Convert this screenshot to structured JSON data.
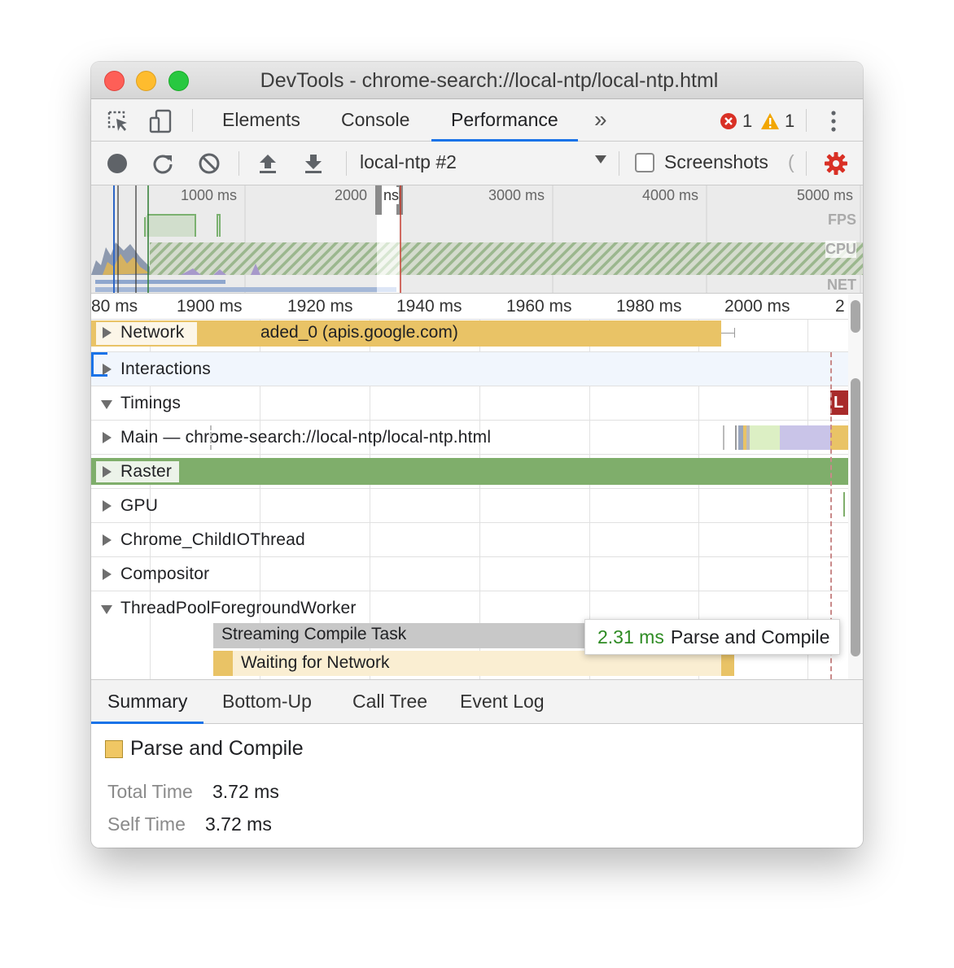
{
  "window": {
    "title": "DevTools - chrome-search://local-ntp/local-ntp.html"
  },
  "tabbar": {
    "tabs": [
      {
        "label": "Elements"
      },
      {
        "label": "Console"
      },
      {
        "label": "Performance"
      }
    ],
    "active_tab": "Performance",
    "more_icon": "chevron-double-right-icon",
    "errors": "1",
    "warnings": "1"
  },
  "toolbar": {
    "target": "local-ntp #2",
    "screenshots_label": "Screenshots",
    "screenshots_checked": false
  },
  "overview": {
    "ticks": [
      "1000 ms",
      "2000",
      "ns",
      "3000 ms",
      "4000 ms",
      "5000 ms"
    ],
    "tracks": [
      "FPS",
      "CPU",
      "NET"
    ]
  },
  "ruler": {
    "ticks": [
      "80 ms",
      "1900 ms",
      "1920 ms",
      "1940 ms",
      "1960 ms",
      "1980 ms",
      "2000 ms",
      "2"
    ]
  },
  "flame": {
    "tracks": [
      {
        "label": "Network",
        "bar_text": "aded_0 (apis.google.com)",
        "expanded": false
      },
      {
        "label": "Interactions",
        "expanded": false
      },
      {
        "label": "Timings",
        "expanded": true,
        "marker": "L"
      },
      {
        "label": "Main — chrome-search://local-ntp/local-ntp.html",
        "expanded": false
      },
      {
        "label": "Raster",
        "expanded": false
      },
      {
        "label": "GPU",
        "expanded": false
      },
      {
        "label": "Chrome_ChildIOThread",
        "expanded": false
      },
      {
        "label": "Compositor",
        "expanded": false
      },
      {
        "label": "ThreadPoolForegroundWorker",
        "expanded": true
      }
    ],
    "events": [
      {
        "label": "Streaming Compile Task"
      },
      {
        "label": "Waiting for Network"
      }
    ]
  },
  "tooltip": {
    "duration": "2.31 ms",
    "name": "Parse and Compile"
  },
  "bottom": {
    "tabs": [
      {
        "label": "Summary"
      },
      {
        "label": "Bottom-Up"
      },
      {
        "label": "Call Tree"
      },
      {
        "label": "Event Log"
      }
    ],
    "active_tab": "Summary"
  },
  "summary": {
    "title": "Parse and Compile",
    "swatch_color": "#f0c764",
    "total_time_label": "Total Time",
    "total_time": "3.72 ms",
    "self_time_label": "Self Time",
    "self_time": "3.72 ms"
  },
  "colors": {
    "accent": "#1a73e8",
    "network_bar": "#e9c366",
    "raster_bar": "#7fae6b",
    "error_red": "#d93025",
    "warning_yellow": "#f2a600",
    "settings_red": "#d93025",
    "timing_marker": "#a82a2a"
  }
}
